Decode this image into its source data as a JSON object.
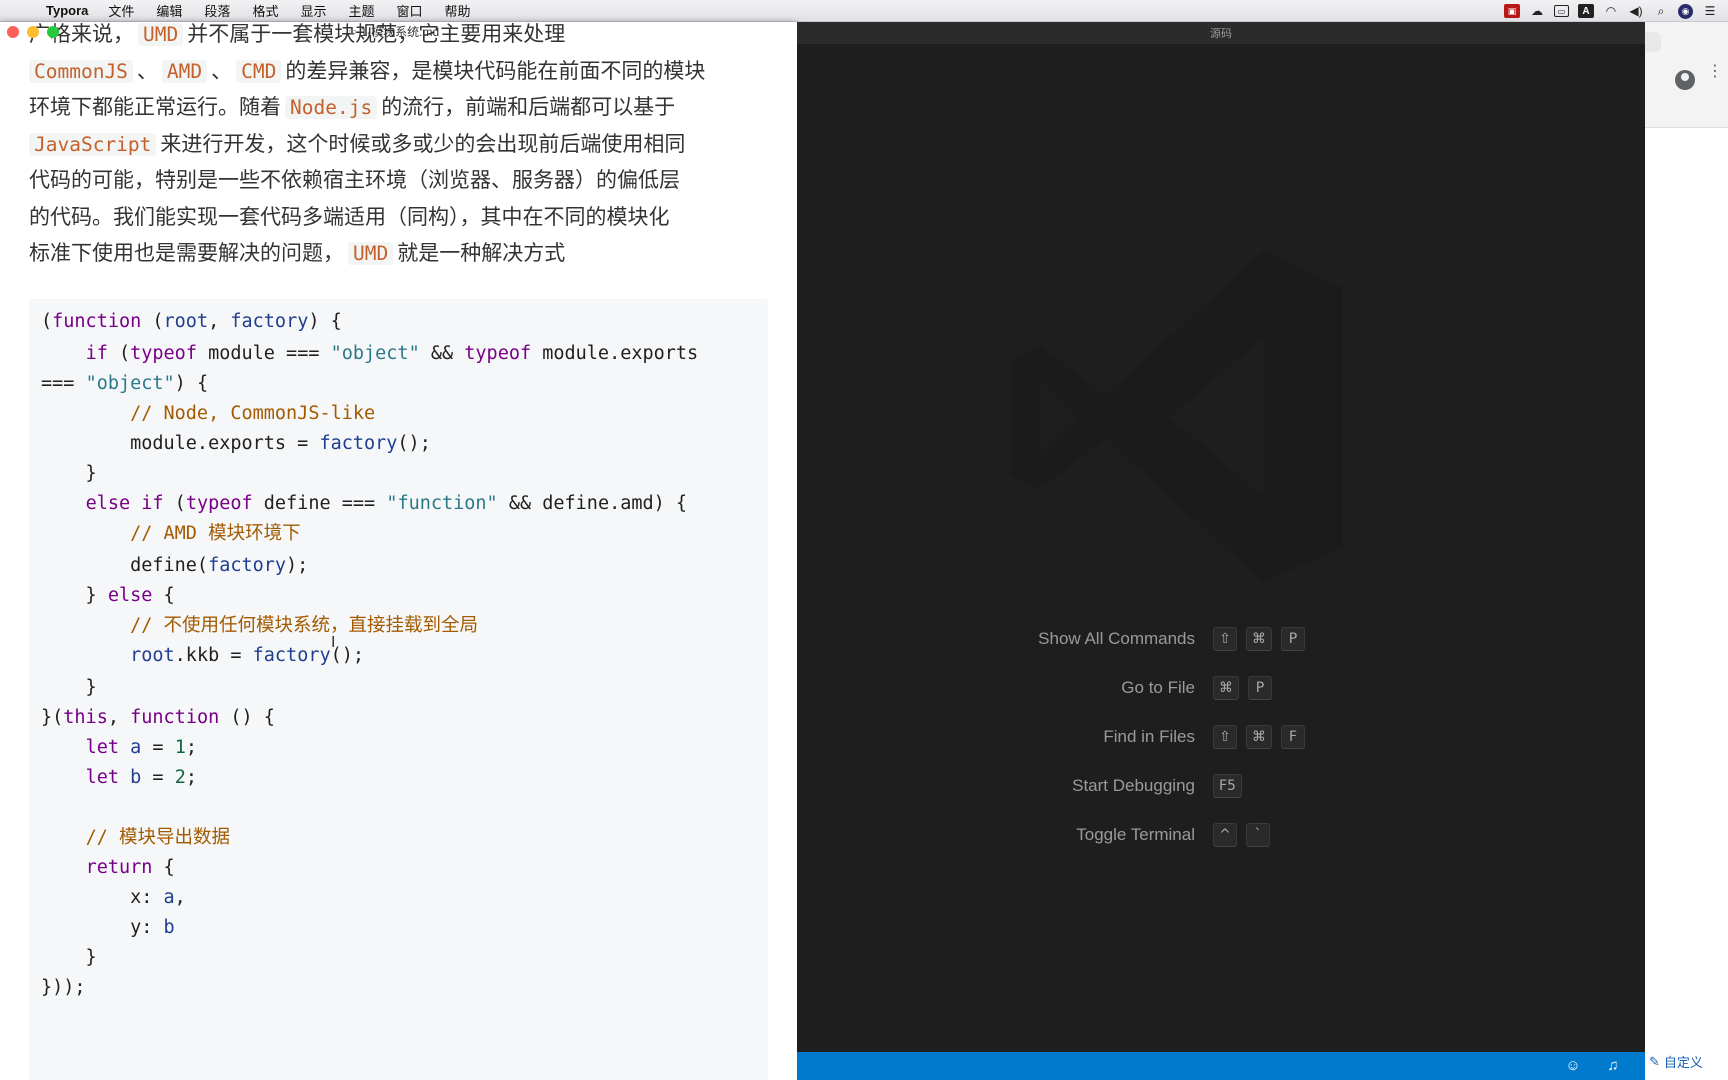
{
  "menubar": {
    "app": "Typora",
    "items": [
      "文件",
      "编辑",
      "段落",
      "格式",
      "显示",
      "主题",
      "窗口",
      "帮助"
    ]
  },
  "typora": {
    "doc_title": "1-模块系统.md",
    "paragraph_lines": [
      "广格来说， UMD 并不属于一套模块规范，它主要用来处理",
      "CommonJS 、 AMD 、 CMD 的差异兼容，是模块代码能在前面不同的模块",
      "环境下都能正常运行。随着 Node.js 的流行，前端和后端都可以基于",
      "JavaScript 来进行开发，这个时候或多或少的会出现前后端使用相同",
      "代码的可能，特别是一些不依赖宿主环境（浏览器、服务器）的偏低层",
      "的代码。我们能实现一套代码多端适用（同构），其中在不同的模块化",
      "标准下使用也是需要解决的问题， UMD 就是一种解决方式"
    ],
    "inline_code": {
      "umd": "UMD",
      "commonjs": "CommonJS",
      "amd": "AMD",
      "cmd": "CMD",
      "nodejs": "Node.js",
      "javascript": "JavaScript"
    },
    "text": {
      "l1a": "广格来说，",
      "l1b": "并不属于一套模块规范，它主要用来处理",
      "sep": "、",
      "l2b": "的差异兼容，是模块代码能在前面不同的模块",
      "l3a": "环境下都能正常运行。随着",
      "l3b": "的流行，前端和后端都可以基于",
      "l4b": "来进行开发，这个时候或多或少的会出现前后端使用相同",
      "l5": "代码的可能，特别是一些不依赖宿主环境（浏览器、服务器）的偏低层",
      "l6": "的代码。我们能实现一套代码多端适用（同构），其中在不同的模块化",
      "l7a": "标准下使用也是需要解决的问题，",
      "l7b": "就是一种解决方式"
    },
    "code_lines": [
      "(function (root, factory) {",
      "    if (typeof module === \"object\" && typeof module.exports",
      "=== \"object\") {",
      "        // Node, CommonJS-like",
      "        module.exports = factory();",
      "    }",
      "    else if (typeof define === \"function\" && define.amd) {",
      "        // AMD 模块环境下",
      "        define(factory);",
      "    } else {",
      "        // 不使用任何模块系统，直接挂载到全局",
      "        root.kkb = factory();",
      "    }",
      "}(this, function () {",
      "    let a = 1;",
      "    let b = 2;",
      "",
      "    // 模块导出数据",
      "    return {",
      "        x: a,",
      "        y: b",
      "    }",
      "}));"
    ]
  },
  "vscode": {
    "title": "源码",
    "shortcuts": [
      {
        "label": "Show All Commands",
        "keys": [
          "⇧",
          "⌘",
          "P"
        ]
      },
      {
        "label": "Go to File",
        "keys": [
          "⌘",
          "P"
        ]
      },
      {
        "label": "Find in Files",
        "keys": [
          "⇧",
          "⌘",
          "F"
        ]
      },
      {
        "label": "Start Debugging",
        "keys": [
          "F5"
        ]
      },
      {
        "label": "Toggle Terminal",
        "keys": [
          "^",
          "`"
        ]
      }
    ],
    "statusbar_color": "#007acc"
  },
  "browser": {
    "custom_label": "自定义"
  },
  "colors": {
    "inline_code": "#c5612a",
    "keyword": "#770088",
    "string": "#2b7a8a",
    "comment": "#a35a00"
  }
}
